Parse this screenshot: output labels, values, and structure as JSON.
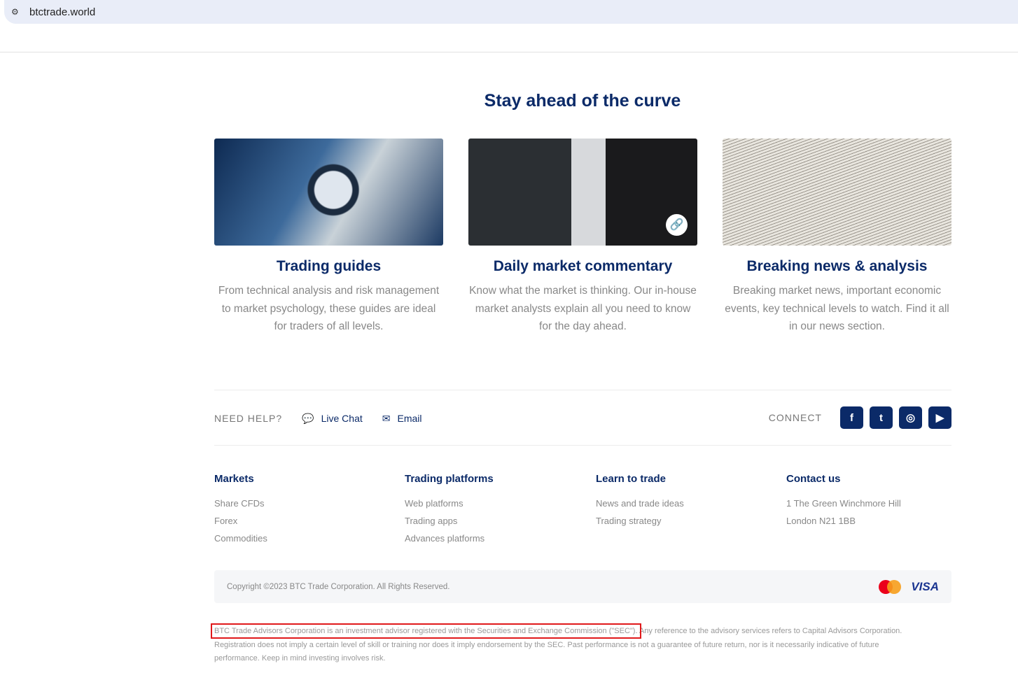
{
  "browser": {
    "url": "btctrade.world"
  },
  "title": "Stay ahead of the curve",
  "cards": [
    {
      "title": "Trading guides",
      "text": "From technical analysis and risk management to market psychology, these guides are ideal for traders of all levels."
    },
    {
      "title": "Daily market commentary",
      "text": "Know what the market is thinking. Our in-house market analysts explain all you need to know for the day ahead."
    },
    {
      "title": "Breaking news & analysis",
      "text": "Breaking market news, important economic events, key technical levels to watch. Find it all in our news section."
    }
  ],
  "help": {
    "label": "NEED HELP?",
    "live_chat": "Live Chat",
    "email": "Email"
  },
  "connect": {
    "label": "CONNECT",
    "icons": [
      "facebook-icon",
      "twitter-icon",
      "instagram-icon",
      "youtube-icon"
    ]
  },
  "footer": [
    {
      "title": "Markets",
      "items": [
        "Share CFDs",
        "Forex",
        "Commodities"
      ]
    },
    {
      "title": "Trading platforms",
      "items": [
        "Web platforms",
        "Trading apps",
        "Advances platforms"
      ]
    },
    {
      "title": "Learn to trade",
      "items": [
        "News and trade ideas",
        "Trading strategy"
      ]
    },
    {
      "title": "Contact us",
      "items": [
        "1 The Green Winchmore Hill",
        "London N21 1BB"
      ]
    }
  ],
  "copyright": "Copyright ©2023 BTC Trade Corporation. All Rights Reserved.",
  "payments": {
    "visa": "VISA"
  },
  "disclaimer": {
    "highlighted": "BTC Trade Advisors Corporation is an investment advisor registered with the Securities and Exchange Commission (\"SEC\").",
    "rest": " Any reference to the advisory services refers to Capital Advisors Corporation. Registration does not imply a certain level of skill or training nor does it imply endorsement by the SEC. Past performance is not a guarantee of future return, nor is it necessarily indicative of future performance. Keep in mind investing involves risk."
  },
  "colors": {
    "brand": "#0b2a68",
    "highlight": "#e0191b"
  }
}
